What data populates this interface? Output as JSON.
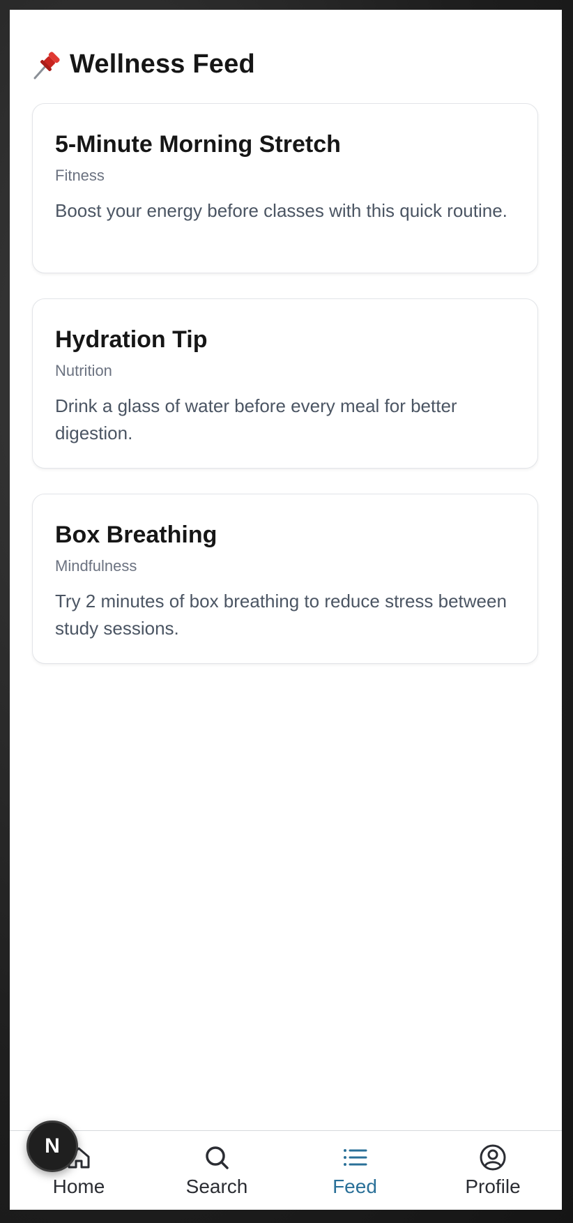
{
  "header": {
    "title": "Wellness Feed",
    "icon": "pushpin-icon"
  },
  "feed": [
    {
      "title": "5-Minute Morning Stretch",
      "category": "Fitness",
      "description": "Boost your energy before classes with this quick routine."
    },
    {
      "title": "Hydration Tip",
      "category": "Nutrition",
      "description": "Drink a glass of water before every meal for better digestion."
    },
    {
      "title": "Box Breathing",
      "category": "Mindfulness",
      "description": "Try 2 minutes of box breathing to reduce stress between study sessions."
    }
  ],
  "nav": {
    "home": "Home",
    "search": "Search",
    "feed": "Feed",
    "profile": "Profile",
    "active": "feed",
    "active_color": "#2a7098"
  },
  "badge": {
    "letter": "N"
  }
}
